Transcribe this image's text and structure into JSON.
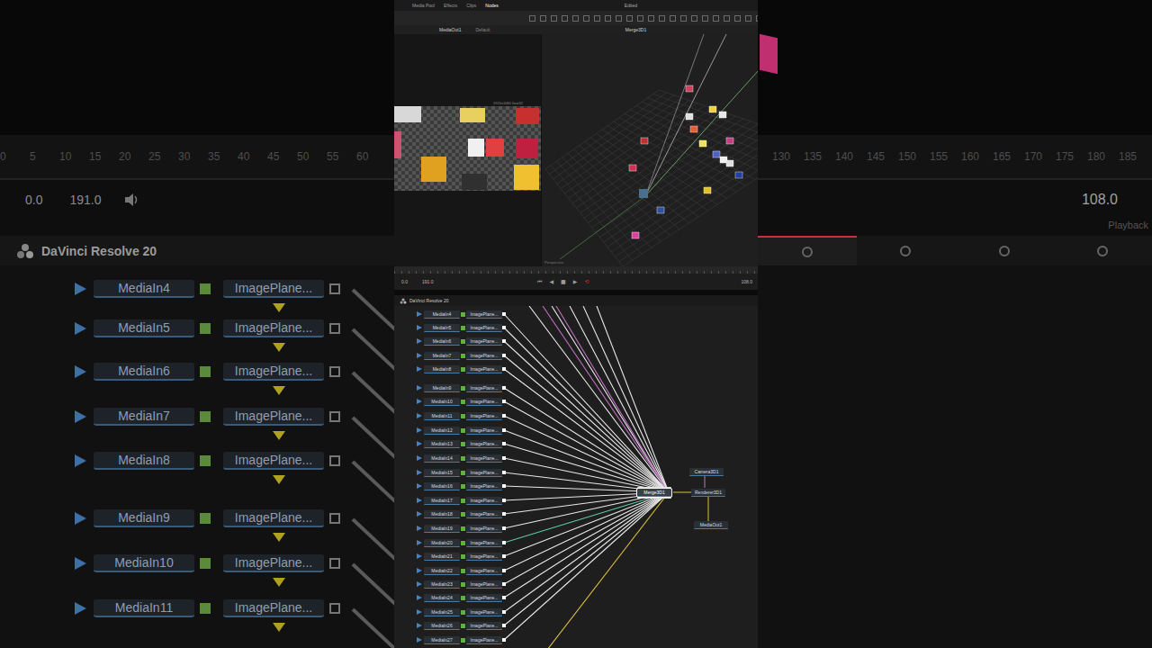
{
  "background_left": {
    "ruler": [
      "0",
      "5",
      "10",
      "15",
      "20",
      "25",
      "30",
      "35",
      "40",
      "45",
      "50",
      "55",
      "60"
    ],
    "start_time": "0.0",
    "end_time": "191.0",
    "app_title": "DaVinci Resolve 20",
    "nodes": [
      {
        "media": "MediaIn4",
        "plane": "ImagePlane..."
      },
      {
        "media": "MediaIn5",
        "plane": "ImagePlane..."
      },
      {
        "media": "MediaIn6",
        "plane": "ImagePlane..."
      },
      {
        "media": "MediaIn7",
        "plane": "ImagePlane..."
      },
      {
        "media": "MediaIn8",
        "plane": "ImagePlane..."
      },
      {
        "media": "MediaIn9",
        "plane": "ImagePlane..."
      },
      {
        "media": "MediaIn10",
        "plane": "ImagePlane..."
      },
      {
        "media": "MediaIn11",
        "plane": "ImagePlane..."
      }
    ]
  },
  "background_right": {
    "ruler": [
      "130",
      "135",
      "140",
      "145",
      "150",
      "155",
      "160",
      "165",
      "170",
      "175",
      "180",
      "185"
    ],
    "current_time": "108.0",
    "label": "Playback",
    "tabs": [
      {
        "selected": true
      },
      {
        "selected": false
      },
      {
        "selected": false
      },
      {
        "selected": false
      }
    ]
  },
  "topbar": {
    "tabs": [
      {
        "label": "Media Pool",
        "selected": false
      },
      {
        "label": "Effects",
        "selected": false
      },
      {
        "label": "Clips",
        "selected": false
      },
      {
        "label": "Nodes",
        "selected": true
      }
    ],
    "title": "Edited"
  },
  "viewer_left": {
    "node": "MediaOut1",
    "lut": "Default",
    "info": "1920x1080 float32",
    "thumbnails": [
      {
        "color": "#d8d8d8"
      },
      {
        "color": "#e8d060"
      },
      {
        "color": "#c83030"
      },
      {
        "color": "#d05070"
      },
      {
        "color": "#f0f0f0"
      },
      {
        "color": "#e04040"
      },
      {
        "color": "#c02040"
      },
      {
        "color": "#e0a020"
      },
      {
        "color": "#303030"
      },
      {
        "color": "#f0c030"
      }
    ]
  },
  "viewer_right": {
    "node": "Merge3D1",
    "label": "Perspective",
    "planes": [
      {
        "color": "#d04060"
      },
      {
        "color": "#e0e0e0"
      },
      {
        "color": "#f0d040"
      },
      {
        "color": "#e8e8e8"
      },
      {
        "color": "#c03030"
      },
      {
        "color": "#e06030"
      },
      {
        "color": "#5060c0"
      },
      {
        "color": "#f0f0f0"
      },
      {
        "color": "#d03050"
      },
      {
        "color": "#e0c030"
      },
      {
        "color": "#3050a0"
      },
      {
        "color": "#e0e0e0"
      },
      {
        "color": "#c04080"
      },
      {
        "color": "#f0e060"
      },
      {
        "color": "#2040a0"
      },
      {
        "color": "#e040a0"
      }
    ]
  },
  "transport": {
    "start": "0.0",
    "end": "191.0",
    "current": "108.0",
    "buttons": [
      {
        "glyph": "⏮",
        "color": "#9a9a9a"
      },
      {
        "glyph": "◀",
        "color": "#9a9a9a"
      },
      {
        "glyph": "■",
        "color": "#9a9a9a"
      },
      {
        "glyph": "▶",
        "color": "#9a9a9a"
      },
      {
        "glyph": "⟲",
        "color": "#d03030"
      }
    ]
  },
  "node_panel": {
    "title": "DaVinci Resolve 20"
  },
  "graph": {
    "inputs": [
      {
        "media": "MediaIn4",
        "plane": "ImagePlane...",
        "wire": "#e8e8e8"
      },
      {
        "media": "MediaIn5",
        "plane": "ImagePlane...",
        "wire": "#e8e8e8"
      },
      {
        "media": "MediaIn6",
        "plane": "ImagePlane...",
        "wire": "#e8e8e8"
      },
      {
        "media": "MediaIn7",
        "plane": "ImagePlane...",
        "wire": "#e8e8e8"
      },
      {
        "media": "MediaIn8",
        "plane": "ImagePlane...",
        "wire": "#e8e8e8"
      },
      {
        "media": "MediaIn9",
        "plane": "ImagePlane...",
        "wire": "#e8e8e8"
      },
      {
        "media": "MediaIn10",
        "plane": "ImagePlane...",
        "wire": "#e8e8e8"
      },
      {
        "media": "MediaIn11",
        "plane": "ImagePlane...",
        "wire": "#e8e8e8"
      },
      {
        "media": "MediaIn12",
        "plane": "ImagePlane...",
        "wire": "#e8e8e8"
      },
      {
        "media": "MediaIn13",
        "plane": "ImagePlane...",
        "wire": "#e8e8e8"
      },
      {
        "media": "MediaIn14",
        "plane": "ImagePlane...",
        "wire": "#e8e8e8"
      },
      {
        "media": "MediaIn15",
        "plane": "ImagePlane...",
        "wire": "#e8e8e8"
      },
      {
        "media": "MediaIn16",
        "plane": "ImagePlane...",
        "wire": "#e8e8e8"
      },
      {
        "media": "MediaIn17",
        "plane": "ImagePlane...",
        "wire": "#e8e8e8"
      },
      {
        "media": "MediaIn18",
        "plane": "ImagePlane...",
        "wire": "#e8e8e8"
      },
      {
        "media": "MediaIn19",
        "plane": "ImagePlane...",
        "wire": "#e8e8e8"
      },
      {
        "media": "MediaIn20",
        "plane": "ImagePlane...",
        "wire": "#5ec8a0"
      },
      {
        "media": "MediaIn21",
        "plane": "ImagePlane...",
        "wire": "#e8e8e8"
      },
      {
        "media": "MediaIn22",
        "plane": "ImagePlane...",
        "wire": "#e8e8e8"
      },
      {
        "media": "MediaIn23",
        "plane": "ImagePlane...",
        "wire": "#e8e8e8"
      },
      {
        "media": "MediaIn24",
        "plane": "ImagePlane...",
        "wire": "#e8e8e8"
      },
      {
        "media": "MediaIn25",
        "plane": "ImagePlane...",
        "wire": "#e8e8e8"
      },
      {
        "media": "MediaIn26",
        "plane": "ImagePlane...",
        "wire": "#e8e8e8"
      },
      {
        "media": "MediaIn27",
        "plane": "ImagePlane...",
        "wire": "#e8e8e8"
      }
    ],
    "offscreen_wires": [
      {
        "color": "#e8e8e8"
      },
      {
        "color": "#e8e8e8"
      },
      {
        "color": "#c070c0"
      },
      {
        "color": "#c070c0"
      },
      {
        "color": "#e8e8e8"
      },
      {
        "color": "#e8e8e8"
      },
      {
        "color": "#e8e8e8"
      },
      {
        "color": "#e0c040"
      }
    ],
    "merge": {
      "label": "Merge3D1",
      "selected": true
    },
    "camera": {
      "label": "Camera3D1",
      "selected": false
    },
    "renderer": {
      "label": "Renderer3D1",
      "selected": false
    },
    "output": {
      "label": "MediaOut1",
      "selected": false
    }
  }
}
